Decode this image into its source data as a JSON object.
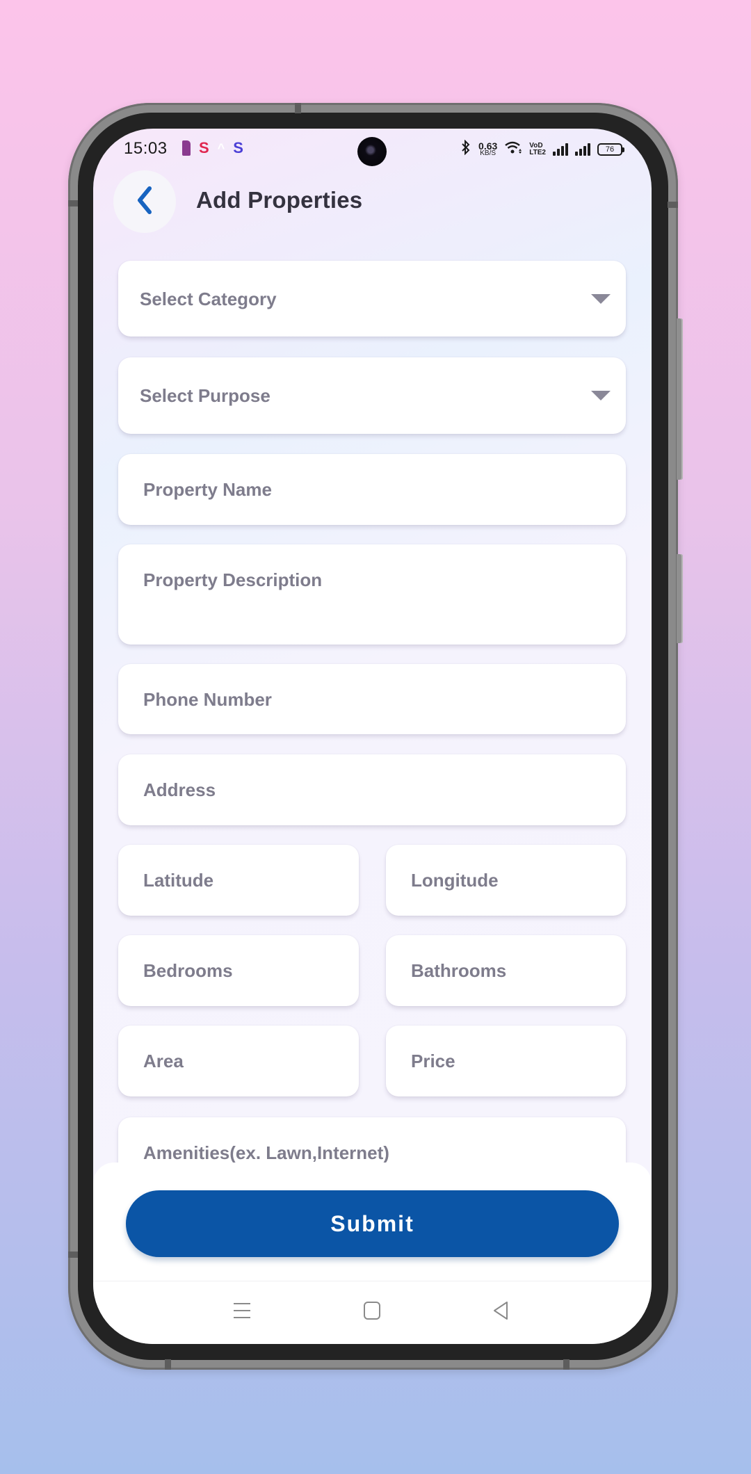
{
  "status_bar": {
    "time": "15:03",
    "notification_icons": [
      "sim-icon",
      "app-s-red-icon",
      "chevron-up-icon",
      "app-s-blue-icon"
    ],
    "network_speed_value": "0.63",
    "network_speed_unit": "KB/S",
    "volte_line1": "VoD",
    "volte_line2": "LTE2",
    "battery_level": "76"
  },
  "header": {
    "title": "Add Properties",
    "back_icon": "chevron-left-icon"
  },
  "form": {
    "category": {
      "placeholder": "Select Category",
      "icon": "caret-down-icon"
    },
    "purpose": {
      "placeholder": "Select Purpose",
      "icon": "caret-down-icon"
    },
    "property_name": {
      "placeholder": "Property Name",
      "value": ""
    },
    "property_description": {
      "placeholder": "Property Description",
      "value": ""
    },
    "phone_number": {
      "placeholder": "Phone Number",
      "value": ""
    },
    "address": {
      "placeholder": "Address",
      "value": ""
    },
    "latitude": {
      "placeholder": "Latitude",
      "value": ""
    },
    "longitude": {
      "placeholder": "Longitude",
      "value": ""
    },
    "bedrooms": {
      "placeholder": "Bedrooms",
      "value": ""
    },
    "bathrooms": {
      "placeholder": "Bathrooms",
      "value": ""
    },
    "area": {
      "placeholder": "Area",
      "value": ""
    },
    "price": {
      "placeholder": "Price",
      "value": ""
    },
    "amenities": {
      "placeholder": "Amenities(ex. Lawn,Internet)",
      "value": ""
    }
  },
  "actions": {
    "submit_label": "Submit"
  },
  "nav_bar": {
    "items": [
      "menu-icon",
      "home-icon",
      "back-icon"
    ]
  },
  "colors": {
    "accent": "#0B55A6",
    "title_text": "#34323F",
    "placeholder_text": "#7E7C8C",
    "background_top": "#FCC4EA",
    "background_bottom": "#A6BFEC"
  }
}
